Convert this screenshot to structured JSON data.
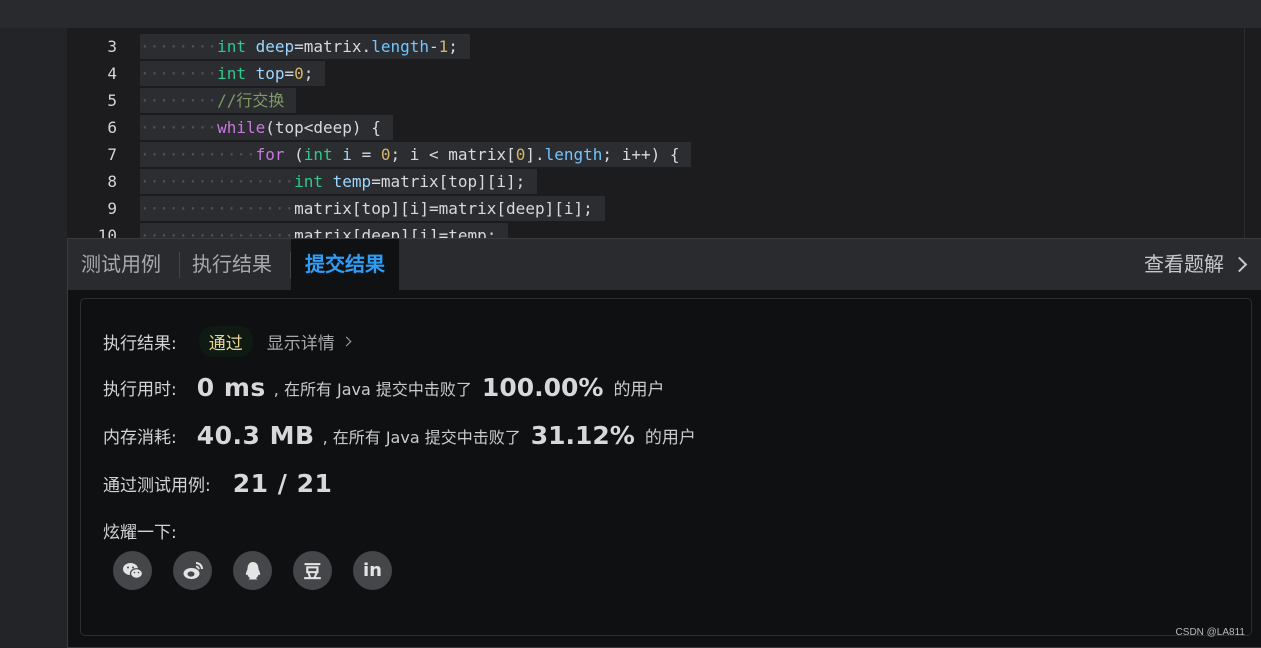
{
  "editor": {
    "lines": [
      {
        "num": "3",
        "indent": "········",
        "tokens": [
          {
            "t": "int ",
            "c": "ty"
          },
          {
            "t": "deep",
            "c": "var"
          },
          {
            "t": "=matrix.",
            "c": ""
          },
          {
            "t": "length",
            "c": "fld"
          },
          {
            "t": "-",
            "c": ""
          },
          {
            "t": "1",
            "c": "num"
          },
          {
            "t": ";",
            "c": ""
          }
        ]
      },
      {
        "num": "4",
        "indent": "········",
        "tokens": [
          {
            "t": "int ",
            "c": "ty"
          },
          {
            "t": "top",
            "c": "var"
          },
          {
            "t": "=",
            "c": ""
          },
          {
            "t": "0",
            "c": "num"
          },
          {
            "t": ";",
            "c": ""
          }
        ]
      },
      {
        "num": "5",
        "indent": "········",
        "tokens": [
          {
            "t": "//行交换",
            "c": "cm"
          }
        ]
      },
      {
        "num": "6",
        "indent": "········",
        "tokens": [
          {
            "t": "while",
            "c": "kw"
          },
          {
            "t": "(top<deep) {",
            "c": ""
          }
        ]
      },
      {
        "num": "7",
        "indent": "············",
        "tokens": [
          {
            "t": "for ",
            "c": "kw"
          },
          {
            "t": "(",
            "c": ""
          },
          {
            "t": "int ",
            "c": "ty"
          },
          {
            "t": "i",
            "c": "var"
          },
          {
            "t": " = ",
            "c": ""
          },
          {
            "t": "0",
            "c": "num"
          },
          {
            "t": "; i < matrix[",
            "c": ""
          },
          {
            "t": "0",
            "c": "num"
          },
          {
            "t": "].",
            "c": ""
          },
          {
            "t": "length",
            "c": "fld"
          },
          {
            "t": "; i++) {",
            "c": ""
          }
        ]
      },
      {
        "num": "8",
        "indent": "················",
        "tokens": [
          {
            "t": "int ",
            "c": "ty"
          },
          {
            "t": "temp",
            "c": "var"
          },
          {
            "t": "=matrix[top][i];",
            "c": ""
          }
        ]
      },
      {
        "num": "9",
        "indent": "················",
        "tokens": [
          {
            "t": "matrix[top][i]=matrix[deep][i];",
            "c": ""
          }
        ]
      },
      {
        "num": "10",
        "indent": "················",
        "tokens": [
          {
            "t": "matrix[deep][i]=temp;",
            "c": ""
          }
        ]
      }
    ]
  },
  "tabs": {
    "testcase": "测试用例",
    "run_result": "执行结果",
    "submit_result": "提交结果",
    "view_solution": "查看题解"
  },
  "result": {
    "status_label": "执行结果:",
    "status_value": "通过",
    "details_link": "显示详情",
    "time_label": "执行用时:",
    "time_value": "0 ms",
    "time_text": ", 在所有 Java 提交中击败了",
    "time_pct": "100.00%",
    "time_suffix": "的用户",
    "mem_label": "内存消耗:",
    "mem_value": "40.3 MB",
    "mem_text": ", 在所有 Java 提交中击败了",
    "mem_pct": "31.12%",
    "mem_suffix": "的用户",
    "cases_label": "通过测试用例:",
    "cases_value": "21 / 21",
    "share_label": "炫耀一下:",
    "share_douban": "豆",
    "share_linkedin": "in"
  },
  "watermark": "CSDN @LA811"
}
